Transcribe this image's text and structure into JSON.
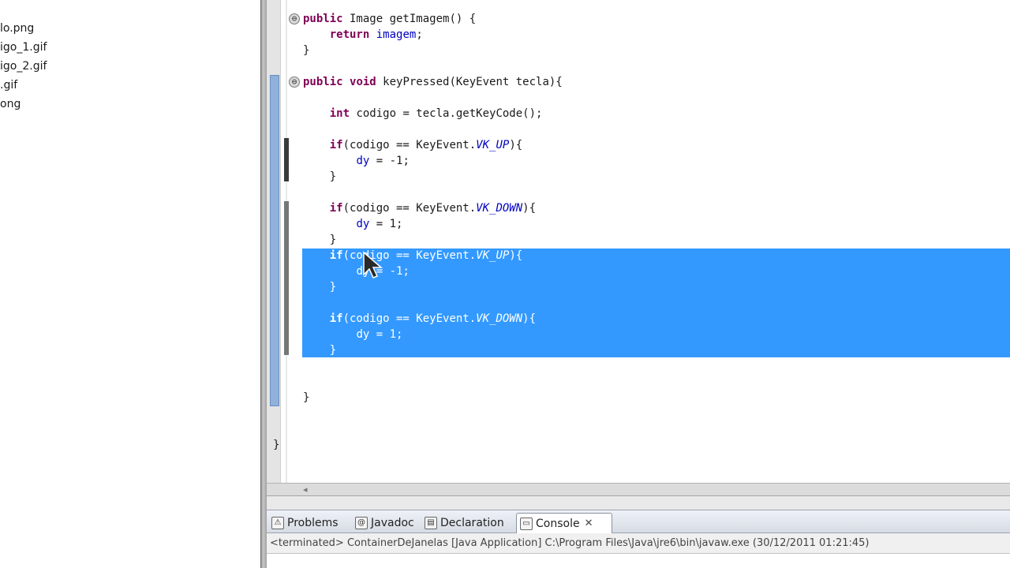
{
  "explorer": {
    "files": [
      "lo.png",
      "igo_1.gif",
      "igo_2.gif",
      ".gif",
      "ong"
    ]
  },
  "editor": {
    "fold_icon": "⊖",
    "lines": [
      "public Image getImagem() {",
      "    return imagem;",
      "}",
      "",
      "public void keyPressed(KeyEvent tecla){",
      "",
      "    int codigo = tecla.getKeyCode();",
      "",
      "    if(codigo == KeyEvent.VK_UP){",
      "        dy = -1;",
      "    }",
      "",
      "    if(codigo == KeyEvent.VK_DOWN){",
      "        dy = 1;",
      "    }",
      "    if(codigo == KeyEvent.VK_UP){",
      "        dy = -1;",
      "    }",
      "",
      "    if(codigo == KeyEvent.VK_DOWN){",
      "        dy = 1;",
      "    }",
      "",
      "",
      "}",
      "",
      "",
      "}"
    ]
  },
  "panel": {
    "tabs": [
      {
        "label": "Problems",
        "icon": "problems-icon"
      },
      {
        "label": "Javadoc",
        "icon": "javadoc-icon"
      },
      {
        "label": "Declaration",
        "icon": "declaration-icon"
      },
      {
        "label": "Console",
        "icon": "console-icon",
        "active": true
      }
    ],
    "console_status": "<terminated> ContainerDeJanelas [Java Application] C:\\Program Files\\Java\\jre6\\bin\\javaw.exe (30/12/2011 01:21:45)"
  },
  "colors": {
    "selection": "#3399ff",
    "keyword": "#7f0055",
    "field": "#0000c0"
  }
}
